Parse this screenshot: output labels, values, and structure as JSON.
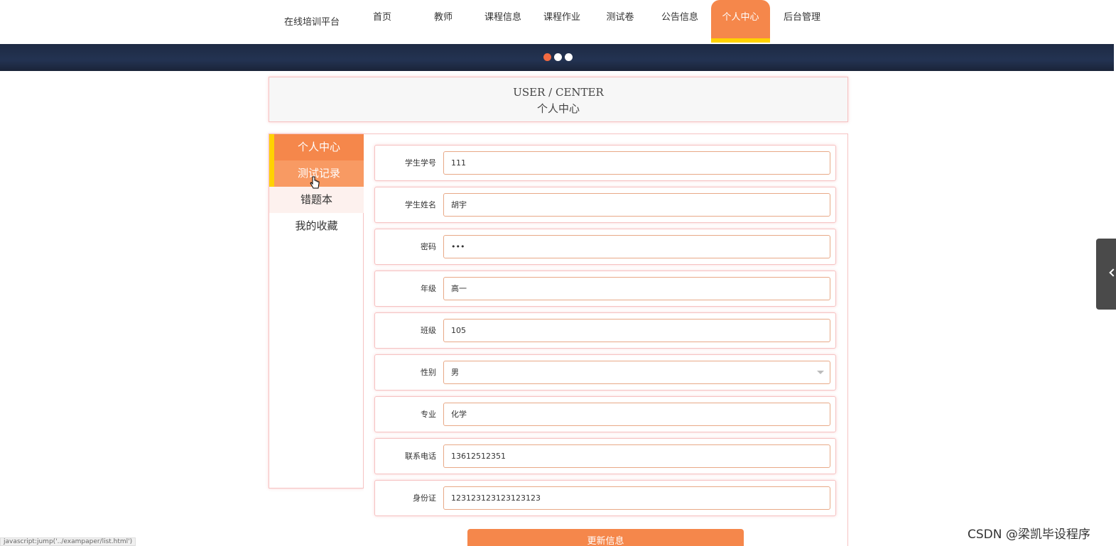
{
  "nav": {
    "brand": "在线培训平台",
    "items": [
      {
        "label": "首页",
        "active": false
      },
      {
        "label": "教师",
        "active": false
      },
      {
        "label": "课程信息",
        "active": false
      },
      {
        "label": "课程作业",
        "active": false
      },
      {
        "label": "测试卷",
        "active": false
      },
      {
        "label": "公告信息",
        "active": false
      },
      {
        "label": "个人中心",
        "active": true
      },
      {
        "label": "后台管理",
        "active": false
      }
    ]
  },
  "banner": {
    "dots": 3,
    "active_dot": 0
  },
  "header": {
    "en": "USER / CENTER",
    "cn": "个人中心"
  },
  "sidebar": {
    "items": [
      {
        "label": "个人中心"
      },
      {
        "label": "测试记录"
      },
      {
        "label": "错题本"
      },
      {
        "label": "我的收藏"
      }
    ]
  },
  "form": {
    "fields": [
      {
        "label": "学生学号",
        "value": "111"
      },
      {
        "label": "学生姓名",
        "value": "胡宇"
      },
      {
        "label": "密码",
        "value": "•••"
      },
      {
        "label": "年级",
        "value": "高一"
      },
      {
        "label": "班级",
        "value": "105"
      },
      {
        "label": "性别",
        "value": "男"
      },
      {
        "label": "专业",
        "value": "化学"
      },
      {
        "label": "联系电话",
        "value": "13612512351"
      },
      {
        "label": "身份证",
        "value": "123123123123123123"
      }
    ],
    "submit_label": "更新信息"
  },
  "status_bar": {
    "url": "javascript:jump('../exampaper/list.html')"
  },
  "watermark": "CSDN @梁凯毕设程序"
}
